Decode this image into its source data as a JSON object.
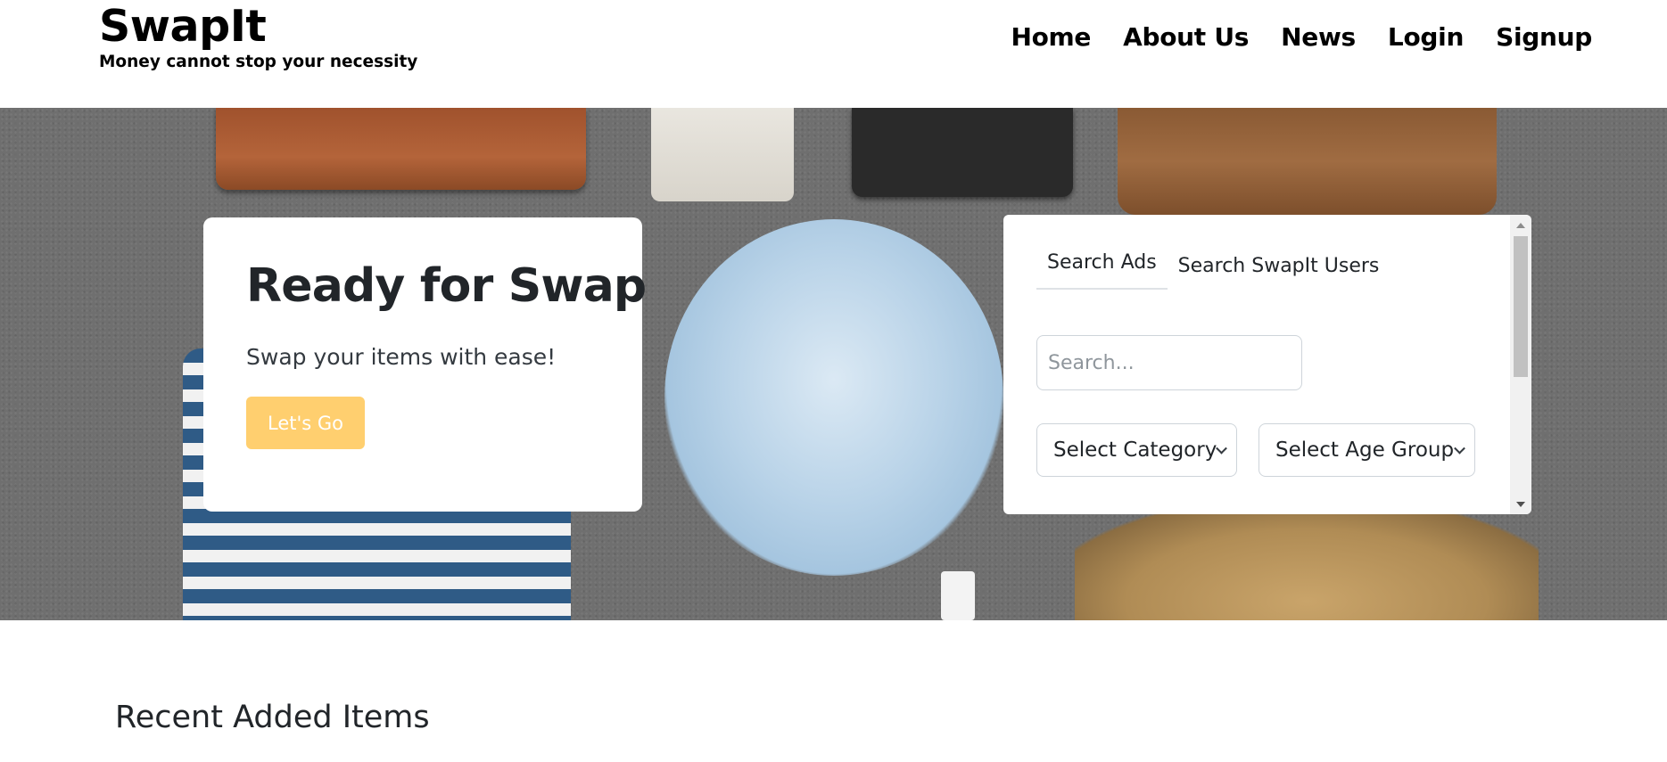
{
  "header": {
    "brand": "SwapIt",
    "tagline": "Money cannot stop your necessity",
    "nav": [
      {
        "label": "Home"
      },
      {
        "label": "About Us"
      },
      {
        "label": "News"
      },
      {
        "label": "Login"
      },
      {
        "label": "Signup"
      }
    ]
  },
  "hero": {
    "heading": "Ready for Swap",
    "subheading": "Swap your items with ease!",
    "cta_label": "Let's Go",
    "cta_color": "#ffcf6f"
  },
  "search_panel": {
    "tabs": [
      {
        "label": "Search Ads",
        "active": true
      },
      {
        "label": "Search SwapIt Users",
        "active": false
      }
    ],
    "search_placeholder": "Search...",
    "category_select": "Select Category",
    "age_group_select": "Select Age Group"
  },
  "recent": {
    "heading": "Recent Added Items"
  }
}
